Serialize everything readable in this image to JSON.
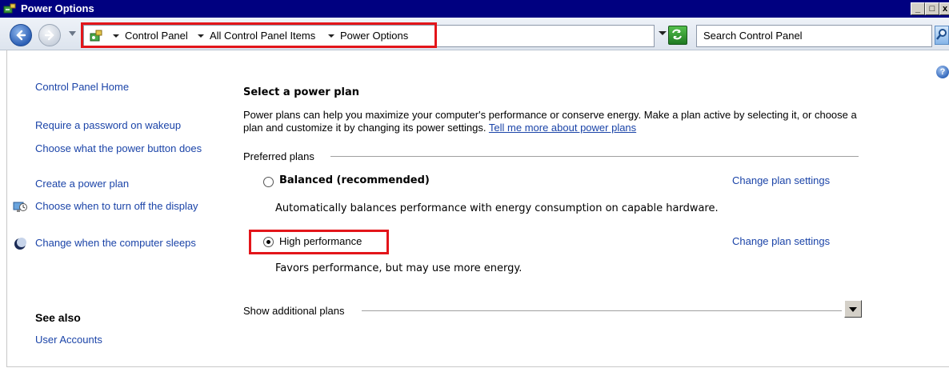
{
  "window": {
    "title": "Power Options",
    "minimize": "_",
    "maximize": "□",
    "close": "x"
  },
  "address": {
    "crumbs": [
      "Control Panel",
      "All Control Panel Items",
      "Power Options"
    ]
  },
  "search": {
    "placeholder": "Search Control Panel"
  },
  "help": {
    "label": "?"
  },
  "sidebar": {
    "home": "Control Panel Home",
    "items": [
      {
        "label": "Require a password on wakeup"
      },
      {
        "label": "Choose what the power button does"
      },
      {
        "label": "Create a power plan"
      },
      {
        "label": "Choose when to turn off the display",
        "icon": "display-icon"
      },
      {
        "label": "Change when the computer sleeps",
        "icon": "moon-icon"
      }
    ],
    "see_also": "See also",
    "see_also_items": [
      {
        "label": "User Accounts"
      }
    ]
  },
  "main": {
    "heading": "Select a power plan",
    "intro": "Power plans can help you maximize your computer's performance or conserve energy. Make a plan active by selecting it, or choose a plan and customize it by changing its power settings.",
    "intro_link": "Tell me more about power plans",
    "preferred_label": "Preferred plans",
    "plans": [
      {
        "name": "Balanced (recommended)",
        "description": "Automatically balances performance with energy consumption on capable hardware.",
        "selected": false,
        "change_label": "Change plan settings"
      },
      {
        "name": "High performance",
        "description": "Favors performance, but may use more energy.",
        "selected": true,
        "change_label": "Change plan settings"
      }
    ],
    "additional_label": "Show additional plans"
  },
  "colors": {
    "titlebar": "#000080",
    "link": "#1b44a8",
    "highlight": "#e3151a"
  }
}
